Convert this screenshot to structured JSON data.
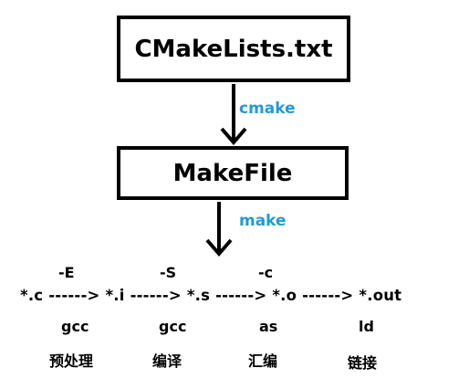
{
  "nodes": {
    "cmakelists": "CMakeLists.txt",
    "makefile": "MakeFile"
  },
  "edges": {
    "cmake": "cmake",
    "make": "make"
  },
  "pipeline": {
    "text": "*.c ------> *.i ------> *.s ------> *.o ------> *.out",
    "flags": [
      "-E",
      "-S",
      "-c"
    ],
    "tools": [
      "gcc",
      "gcc",
      "as",
      "ld"
    ],
    "stages": [
      "预处理",
      "编译",
      "汇编",
      "链接"
    ]
  },
  "colors": {
    "edge_label": "#1f9bd7",
    "stroke": "#000000"
  }
}
